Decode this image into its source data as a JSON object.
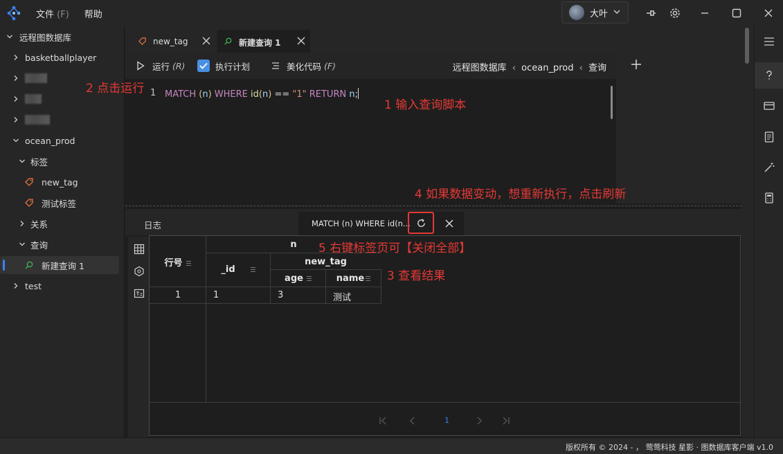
{
  "titlebar": {
    "menu": [
      {
        "label": "文件",
        "accel": "(F)"
      },
      {
        "label": "帮助",
        "accel": ""
      }
    ],
    "user_name": "大叶",
    "icons": [
      "pin-icon",
      "gear-icon",
      "minimize-icon",
      "maximize-icon",
      "close-icon"
    ]
  },
  "sidebar": {
    "items": [
      {
        "label": "远程图数据库",
        "level": 0,
        "expanded": true
      },
      {
        "label": "basketballplayer",
        "level": 1,
        "expanded": false
      },
      {
        "label": "",
        "level": 1,
        "expanded": false,
        "blurred": true
      },
      {
        "label": "",
        "level": 1,
        "expanded": false,
        "blurred": true
      },
      {
        "label": "",
        "level": 1,
        "expanded": false,
        "blurred": true
      },
      {
        "label": "ocean_prod",
        "level": 1,
        "expanded": true
      },
      {
        "label": "标签",
        "level": 2,
        "expanded": true
      },
      {
        "label": "new_tag",
        "level": 3,
        "icon": "tag-icon"
      },
      {
        "label": "测试标签",
        "level": 3,
        "icon": "tag-icon"
      },
      {
        "label": "关系",
        "level": 2,
        "expanded": false
      },
      {
        "label": "查询",
        "level": 2,
        "expanded": true
      },
      {
        "label": "新建查询 1",
        "level": 3,
        "icon": "search-icon",
        "selected": true
      },
      {
        "label": "test",
        "level": 1,
        "expanded": false
      }
    ]
  },
  "editor": {
    "tabs": [
      {
        "label": "new_tag",
        "icon": "tag-icon",
        "active": false
      },
      {
        "label": "新建查询 1",
        "icon": "search-icon",
        "active": true
      }
    ],
    "toolbar": {
      "run_label": "运行",
      "run_accel": "(R)",
      "plan_label": "执行计划",
      "plan_checked": true,
      "beautify_label": "美化代码",
      "beautify_accel": "(F)"
    },
    "breadcrumb": {
      "parts": [
        "远程图数据库",
        "ocean_prod",
        "查询"
      ],
      "separator": "‹"
    },
    "line_number": "1",
    "code_tokens": {
      "t1": "MATCH ",
      "t2": "(",
      "t3": "n",
      "t4": ")",
      "t5": " WHERE ",
      "t6": "id",
      "t7": "(",
      "t8": "n",
      "t9": ")",
      "t10": " == ",
      "t11": "\"1\"",
      "t12": " RETURN ",
      "t13": "n",
      "t14": ";"
    }
  },
  "results": {
    "log_tab": "日志",
    "query_tab_title": "MATCH (n) WHERE id(n...",
    "headers": {
      "row_no": "行号",
      "n": "n",
      "id": "_id",
      "new_tag": "new_tag",
      "age": "age",
      "name": "name"
    },
    "rows": [
      {
        "row_no": "1",
        "id": "1",
        "age": "3",
        "name": "测试"
      }
    ],
    "pager": {
      "current": "1"
    }
  },
  "annotations": {
    "a1": "1 输入查询脚本",
    "a2": "2 点击运行",
    "a3": "3 查看结果",
    "a4": "4 如果数据变动，想重新执行，点击刷新",
    "a5": "5 右键标签页可【关闭全部】"
  },
  "footer": {
    "text": "版权所有 © 2024 - ，  莺莺科技  星影 · 图数据库客户端  v1.0"
  },
  "colors": {
    "accent": "#4a90e2",
    "annotation": "#e53935",
    "keyword": "#c586c0",
    "string": "#ce9178"
  }
}
